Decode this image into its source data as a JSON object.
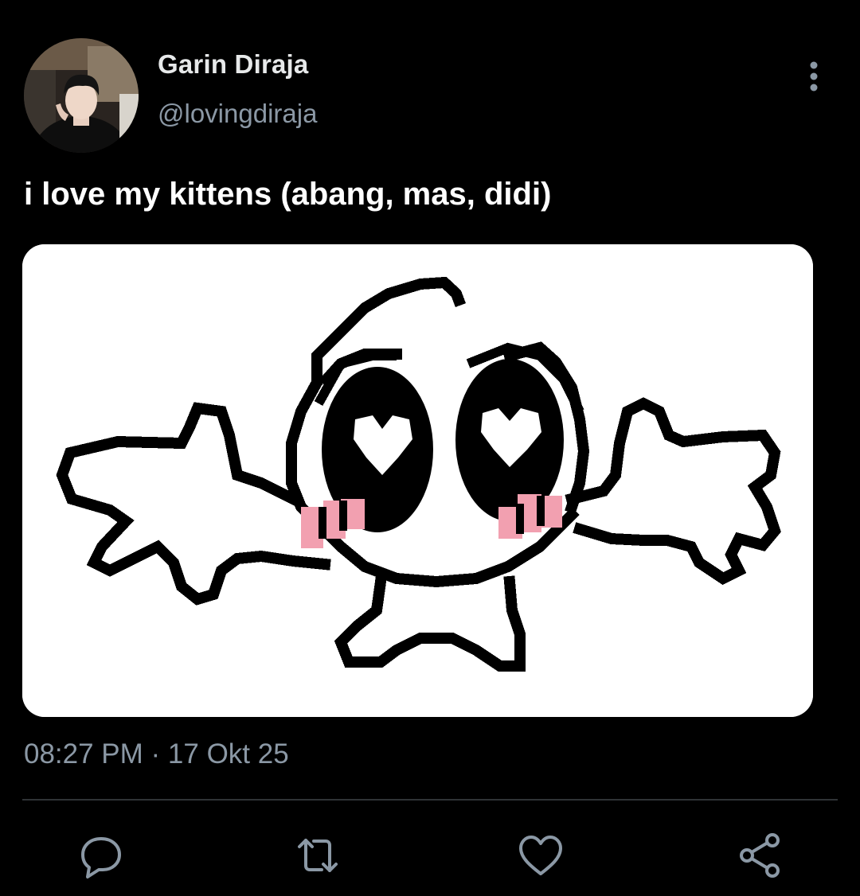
{
  "tweet": {
    "author": {
      "display_name": "Garin Diraja",
      "handle": "@lovingdiraja"
    },
    "text": "i love my kittens (abang, mas, didi)",
    "timestamp": "08:27 PM · 17 Okt 25"
  },
  "icons": {
    "avatar": "profile-photo",
    "more": "more-vertical-icon",
    "reply": "reply-icon",
    "retweet": "retweet-icon",
    "like": "heart-icon",
    "share": "share-icon"
  },
  "colors": {
    "background": "#000000",
    "primary_text": "#e7e9ea",
    "secondary_text": "#8b98a5",
    "divider": "#2f3336",
    "blush": "#f2a0b0"
  }
}
